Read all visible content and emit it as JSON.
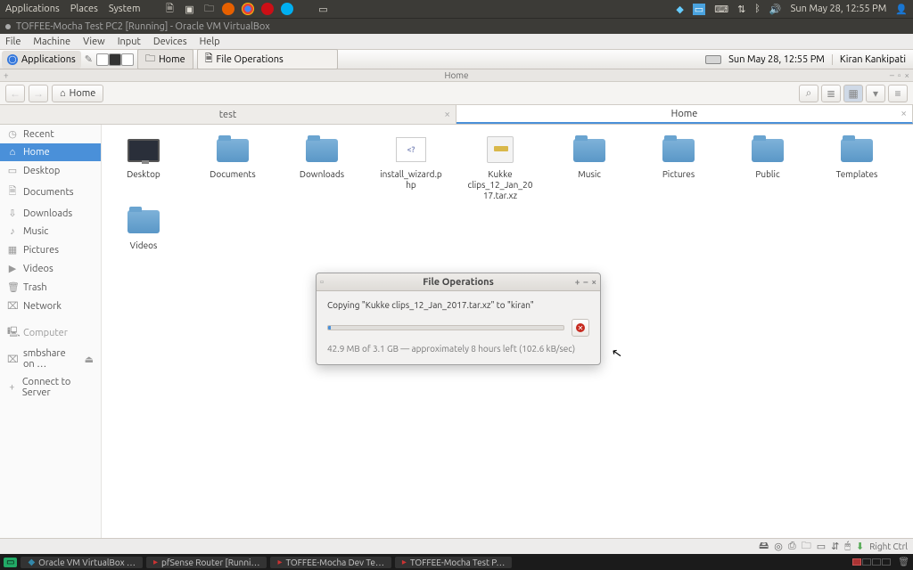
{
  "host_panel": {
    "menus": [
      "Applications",
      "Places",
      "System"
    ],
    "clock": "Sun May 28, 12:55 PM"
  },
  "host_window_title": "TOFFEE-Mocha Test PC2 [Running] - Oracle VM VirtualBox",
  "vm_menu": [
    "File",
    "Machine",
    "View",
    "Input",
    "Devices",
    "Help"
  ],
  "guest_bar": {
    "applications": "Applications",
    "tasks": [
      {
        "label": "Home",
        "icon": "home"
      },
      {
        "label": "File Operations",
        "icon": "doc"
      }
    ],
    "clock": "Sun May 28, 12:55 PM",
    "user": "Kiran Kankipati"
  },
  "fm": {
    "title": "Home",
    "path_label": "Home",
    "tabs": [
      {
        "label": "test",
        "active": false
      },
      {
        "label": "Home",
        "active": true
      }
    ],
    "sidebar": [
      {
        "label": "Recent",
        "icon": "◷"
      },
      {
        "label": "Home",
        "icon": "⌂",
        "active": true
      },
      {
        "label": "Desktop",
        "icon": "▭"
      },
      {
        "label": "Documents",
        "icon": "🗎"
      },
      {
        "label": "Downloads",
        "icon": "⇩"
      },
      {
        "label": "Music",
        "icon": "♪"
      },
      {
        "label": "Pictures",
        "icon": "▦"
      },
      {
        "label": "Videos",
        "icon": "▶"
      },
      {
        "label": "Trash",
        "icon": "🗑"
      },
      {
        "label": "Network",
        "icon": "⌧"
      },
      {
        "label": "Computer",
        "icon": "🖳",
        "header": true
      },
      {
        "label": "smbshare on …",
        "icon": "⌧",
        "eject": true
      },
      {
        "label": "Connect to Server",
        "icon": "+"
      }
    ],
    "items": [
      {
        "label": "Desktop",
        "type": "desktop"
      },
      {
        "label": "Documents",
        "type": "folder"
      },
      {
        "label": "Downloads",
        "type": "folder"
      },
      {
        "label": "install_wizard.php",
        "type": "php"
      },
      {
        "label": "Kukke clips_12_Jan_2017.tar.xz",
        "type": "archive"
      },
      {
        "label": "Music",
        "type": "folder"
      },
      {
        "label": "Pictures",
        "type": "folder"
      },
      {
        "label": "Public",
        "type": "folder"
      },
      {
        "label": "Templates",
        "type": "folder"
      },
      {
        "label": "Videos",
        "type": "folder"
      }
    ]
  },
  "dialog": {
    "title": "File Operations",
    "copying": "Copying \"Kukke clips_12_Jan_2017.tar.xz\" to \"kiran\"",
    "status": "42.9 MB of 3.1 GB — approximately 8 hours left (102.6 kB/sec)",
    "progress_pct": 1.3
  },
  "vb_status": {
    "right_ctrl": "Right Ctrl"
  },
  "host_taskbar": {
    "items": [
      "Oracle VM VirtualBox …",
      "pfSense Router [Runni…",
      "TOFFEE-Mocha Dev Te…",
      "TOFFEE-Mocha Test P…"
    ]
  }
}
